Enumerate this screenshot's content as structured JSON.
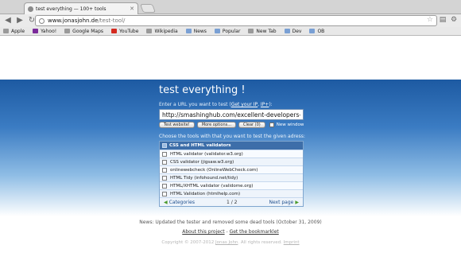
{
  "browser": {
    "tab_title": "test everything — 100+ tools",
    "url_host": "www.jonasjohn.de",
    "url_path": "/test-tool/",
    "bookmarks": [
      {
        "label": "Apple",
        "icon": "apple-icon",
        "color": "#9a9a9a"
      },
      {
        "label": "Yahoo!",
        "icon": "yahoo-icon",
        "color": "#7b2a9a"
      },
      {
        "label": "Google Maps",
        "icon": "google-maps-icon",
        "color": "#9a9a9a"
      },
      {
        "label": "YouTube",
        "icon": "youtube-icon",
        "color": "#d42a1f"
      },
      {
        "label": "Wikipedia",
        "icon": "wikipedia-icon",
        "color": "#9a9a9a"
      },
      {
        "label": "News",
        "icon": "folder-icon",
        "color": "#7aa0d4"
      },
      {
        "label": "Popular",
        "icon": "folder-icon",
        "color": "#7aa0d4"
      },
      {
        "label": "New Tab",
        "icon": "page-icon",
        "color": "#9a9a9a"
      },
      {
        "label": "Dev",
        "icon": "folder-icon",
        "color": "#7aa0d4"
      },
      {
        "label": "OB",
        "icon": "folder-icon",
        "color": "#7aa0d4"
      }
    ]
  },
  "page": {
    "title": "test everything !",
    "prompt_text": "Enter a URL you want to test (",
    "prompt_link1": "Get your IP",
    "prompt_sep": ", ",
    "prompt_link2": "IP+",
    "prompt_end": "):",
    "url_value": "http://smashinghub.com/excellent-developers-websites.htm",
    "buttons": {
      "test": "Test website!",
      "more": "More options...",
      "clear": "Clear (0)"
    },
    "new_window_label": "New window",
    "choose_text": "Choose the tools with that you want to test the given adress:",
    "category_header": "CSS and HTML validators",
    "tools": [
      "HTML validator (validator.w3.org)",
      "CSS validator (jigsaw.w3.org)",
      "onlinewebcheck (OnlineWebCheck.com)",
      "HTML Tidy (infohound.net/tidy)",
      "HTML/XHTML validator (validome.org)",
      "HTML Validation (htmlhelp.com)"
    ],
    "pager": {
      "prev": "Categories",
      "count": "1 / 2",
      "next": "Next page"
    },
    "news": "News: Updated the tester and removed some dead tools (October 31, 2009)",
    "about_link": "About this project",
    "links_sep": " - ",
    "bookmarklet_link": "Get the bookmarklet",
    "copyright_prefix": "Copyright © 2007-2012 ",
    "copyright_author": "Jonas John",
    "copyright_mid": ". All rights reserved. ",
    "copyright_imprint": "Imprint"
  },
  "colors": {
    "hero_top": "#1d5aa2",
    "header_bar": "#3d6ea9",
    "pager_arrow": "#4a9a2a"
  }
}
